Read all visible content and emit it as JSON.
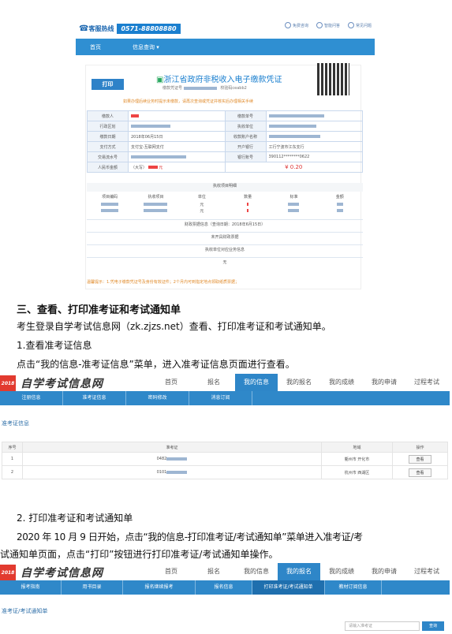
{
  "receipt": {
    "hotline_label": "客服热线",
    "hotline_number": "0571-88808880",
    "top_links": [
      "免费咨询",
      "智能问答",
      "常见问题"
    ],
    "nav": [
      "首页",
      "信息查询 ▾"
    ],
    "print_label": "打印",
    "title": "浙江省政府非税收入电子缴款凭证",
    "sub_prefix": "缴款凭证号",
    "check_code": "校验码ceabb2",
    "warning": "如果办理后续业务时提示未缴款，请再次查询或凭证并核实后办理相关手续",
    "labels": {
      "payer": "缴款人",
      "payer_no": "缴款单号",
      "region": "行政区划",
      "unit": "执收单位",
      "date_label": "缴款日期",
      "acct_name": "收款账户名称",
      "method_label": "支付方式",
      "bank_label": "开户银行",
      "serial": "交易流水号",
      "acct_no": "银行账号",
      "amount_label": "人民币金额"
    },
    "date_value": "2018年06月15日",
    "method_value": "支付宝-互联网支付",
    "bank_value": "工行宁波市江东支行",
    "account_value": "390112********0622",
    "amount_upper": "（大写）",
    "amount_upper_unit": "元",
    "amount_value": "¥ 0.20",
    "detail_header": "执收项目明细",
    "detail_cols": [
      "项目编码",
      "执收项目",
      "单位",
      "数量",
      "标准",
      "金额"
    ],
    "detail_units": [
      "元",
      "元"
    ],
    "finance_line": "财政票据信息（查询日期：2018年6月15日）",
    "no_invoice": "未开具财政票据",
    "unit_info": "执收单位对应业务信息",
    "none": "无",
    "tip": "温馨提示：1.凭电子缴款凭证号及身份有效证件；2个月内可到指定地点领取纸质票据；"
  },
  "doc": {
    "section_title": "三、查看、打印准考证和考试通知单",
    "p1": "考生登录自学考试信息网（zk.zjzs.net）查看、打印准考证和考试通知单。",
    "step1": "1.查看准考证信息",
    "p2": "点击“我的信息-准考证信息”菜单，进入准考证信息页面进行查看。",
    "step2": "2. 打印准考证和考试通知单",
    "p3a": "2020 年 10 月 9 日开始，点击“我的信息-打印准考证/考试通知单”菜单进入准考证/考",
    "p3b": "试通知单页面，点击“打印”按钮进行打印准考证/考试通知单操作。"
  },
  "site": {
    "logo_badge": "2018",
    "logo_text": "自学考试信息网",
    "tabs": [
      "首页",
      "报名",
      "我的信息",
      "我的报名",
      "我的成绩",
      "我的申请",
      "过程考试"
    ],
    "sub1": [
      "注册信息",
      "准考证信息",
      "密码修改",
      "消息订阅"
    ],
    "section1": "准考证信息",
    "table_cols": [
      "序号",
      "准考证",
      "地域",
      "操作"
    ],
    "rows": [
      {
        "no": "1",
        "id": "0482",
        "region": "衢州市 开化市",
        "action": "查看"
      },
      {
        "no": "2",
        "id": "0101",
        "region": "杭州市 西湖区",
        "action": "查看"
      }
    ],
    "sub2": [
      "报考指南",
      "用书目录",
      "报名继续报考",
      "报名信息",
      "打印准考证/考试通知单",
      "教材订阅信息"
    ],
    "section2": "准考证/考试通知单",
    "search_placeholder": "请输入准考证",
    "search_btn": "查询"
  }
}
